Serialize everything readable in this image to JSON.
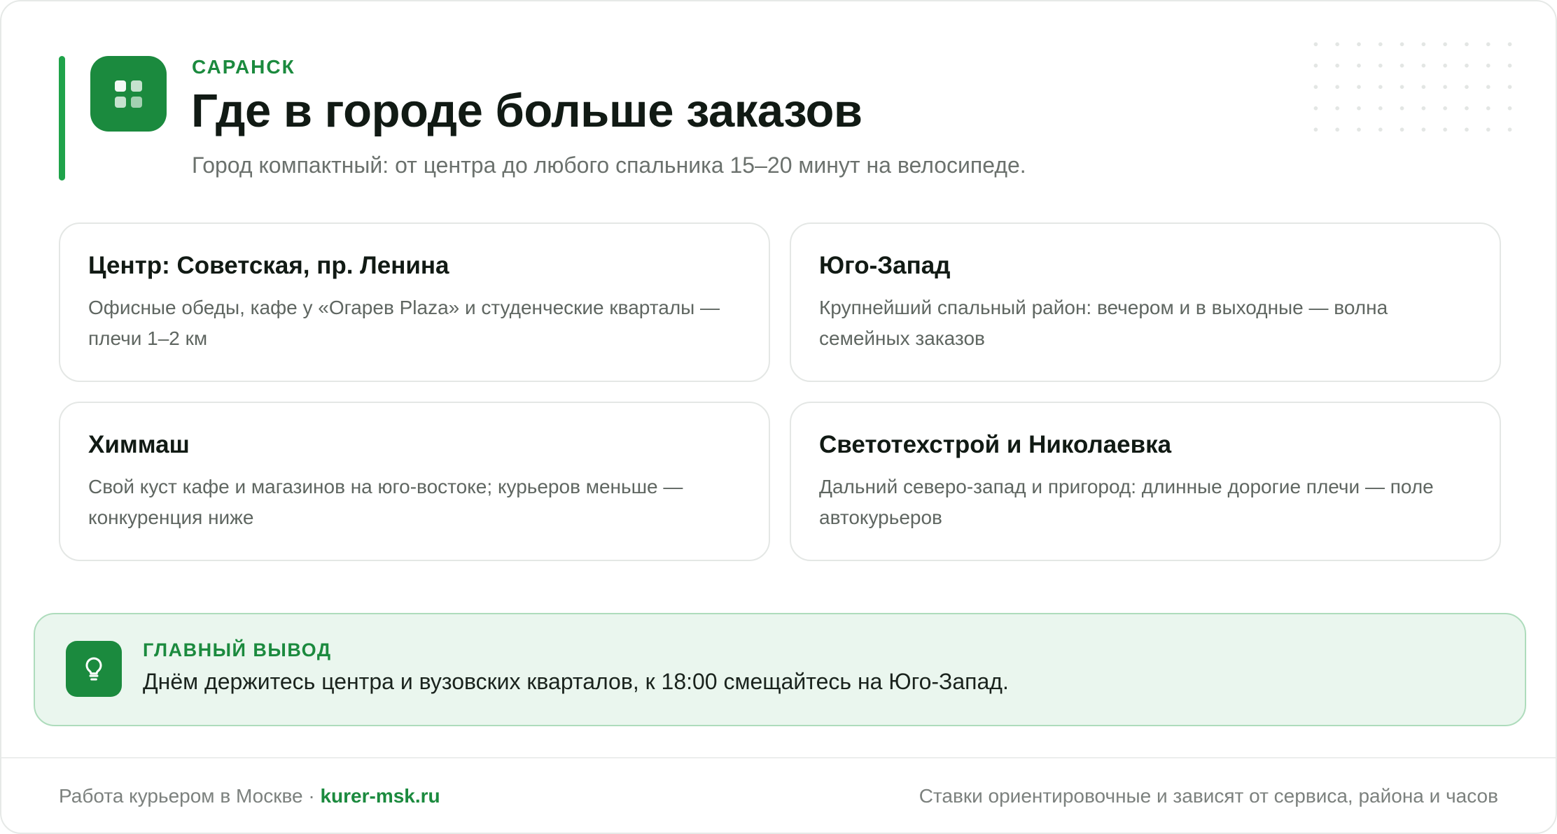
{
  "header": {
    "eyebrow": "САРАНСК",
    "title": "Где в городе больше заказов",
    "subtitle": "Город компактный: от центра до любого спальника 15–20 минут на велосипеде.",
    "icon": "grid-apps-icon"
  },
  "zones": [
    {
      "title": "Центр: Советская, пр. Ленина",
      "description": "Офисные обеды, кафе у «Огарев Plaza» и студенческие кварталы — плечи 1–2 км"
    },
    {
      "title": "Юго-Запад",
      "description": "Крупнейший спальный район: вечером и в выходные — волна семейных заказов"
    },
    {
      "title": "Химмаш",
      "description": "Свой куст кафе и магазинов на юго-востоке; курьеров меньше — конкуренция ниже"
    },
    {
      "title": "Светотехстрой и Николаевка",
      "description": "Дальний северо-запад и пригород: длинные дорогие плечи — поле автокурьеров"
    }
  ],
  "conclusion": {
    "icon": "lightbulb-icon",
    "label": "ГЛАВНЫЙ ВЫВОД",
    "text": "Днём держитесь центра и вузовских кварталов, к 18:00 смещайтесь на Юго-Запад."
  },
  "footer": {
    "left_text": "Работа курьером в Москве · ",
    "link_text": "kurer-msk.ru",
    "right_text": "Ставки ориентировочные и зависят от сервиса, района и часов"
  },
  "colors": {
    "accent": "#1b8a3e",
    "accent_bar": "#1fa34a",
    "conclusion_bg": "#eaf6ee",
    "conclusion_border": "#aedcbc"
  }
}
